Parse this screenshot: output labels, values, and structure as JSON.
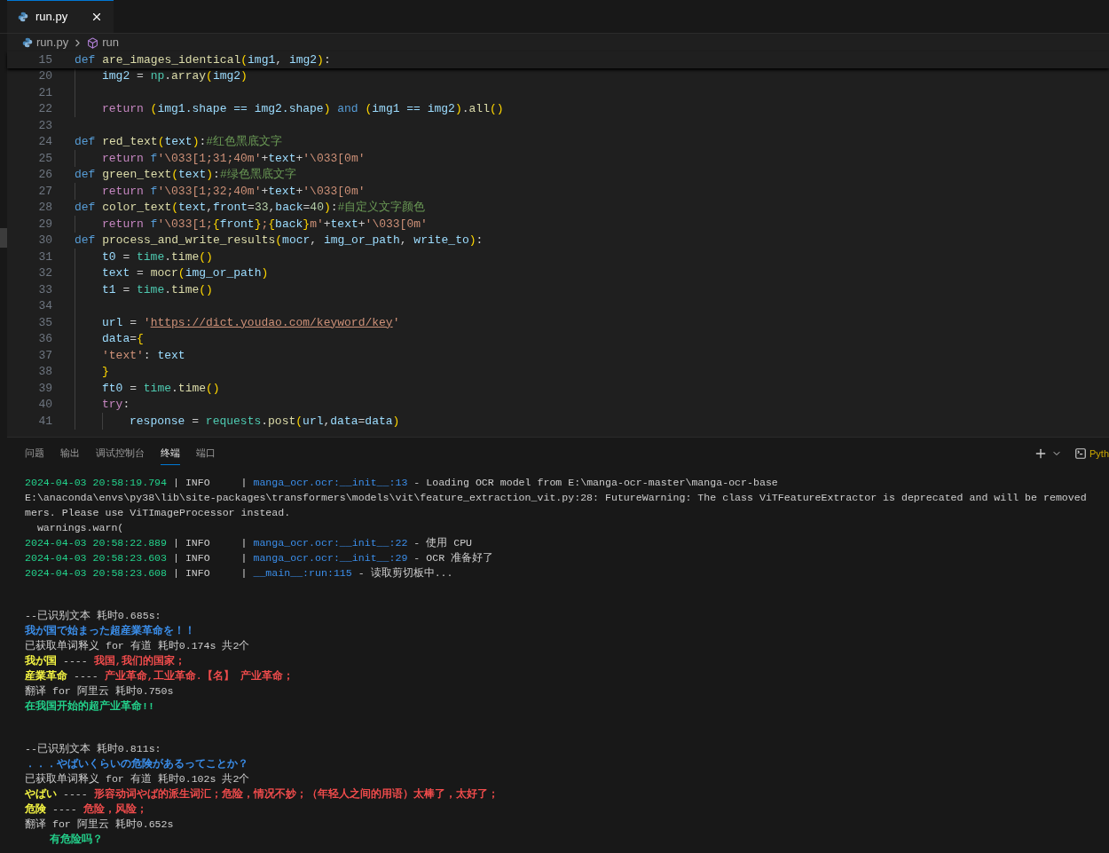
{
  "tabs": [
    {
      "label": "run.py",
      "selected": true
    }
  ],
  "breadcrumb": [
    "run.py",
    "run"
  ],
  "code": [
    {
      "number": "15",
      "tokens": [
        {
          "kind": "kw",
          "text": "def "
        },
        {
          "kind": "fn",
          "text": "are_images_identical"
        },
        {
          "kind": "paren",
          "text": "("
        },
        {
          "kind": "param",
          "text": "img1"
        },
        {
          "kind": "plain",
          "text": ", "
        },
        {
          "kind": "param",
          "text": "img2"
        },
        {
          "kind": "paren",
          "text": ")"
        },
        {
          "kind": "plain",
          "text": ":"
        }
      ],
      "children": [
        {
          "number": "20",
          "tokens": [
            {
              "kind": "param",
              "text": "img2"
            },
            {
              "kind": "plain",
              "text": " = "
            },
            {
              "kind": "builtin",
              "text": "np"
            },
            {
              "kind": "plain",
              "text": "."
            },
            {
              "kind": "fn",
              "text": "array"
            },
            {
              "kind": "paren",
              "text": "("
            },
            {
              "kind": "param",
              "text": "img2"
            },
            {
              "kind": "paren",
              "text": ")"
            }
          ]
        },
        {
          "number": "21"
        },
        {
          "number": "22",
          "tokens": [
            {
              "kind": "ctrl",
              "text": "return "
            },
            {
              "kind": "paren",
              "text": "("
            },
            {
              "kind": "param",
              "text": "img1.shape == img2.shape"
            },
            {
              "kind": "paren",
              "text": ")"
            },
            {
              "kind": "kw",
              "text": " and "
            },
            {
              "kind": "paren",
              "text": "("
            },
            {
              "kind": "param",
              "text": "img1 == img2"
            },
            {
              "kind": "paren",
              "text": ")"
            },
            {
              "kind": "plain",
              "text": "."
            },
            {
              "kind": "fn",
              "text": "all"
            },
            {
              "kind": "paren",
              "text": "()"
            }
          ]
        }
      ]
    },
    {
      "number": "23"
    },
    {
      "number": "24",
      "tokens": [
        {
          "kind": "kw",
          "text": "def "
        },
        {
          "kind": "fn",
          "text": "red_text"
        },
        {
          "kind": "paren",
          "text": "("
        },
        {
          "kind": "param",
          "text": "text"
        },
        {
          "kind": "paren",
          "text": ")"
        },
        {
          "kind": "plain",
          "text": ":"
        },
        {
          "kind": "comment",
          "text": "#红色黑底文字"
        }
      ],
      "children": [
        {
          "number": "25",
          "tokens": [
            {
              "kind": "ctrl",
              "text": "return "
            },
            {
              "kind": "kw",
              "text": "f"
            },
            {
              "kind": "string",
              "text": "'\\033[1;31;40m'"
            },
            {
              "kind": "plain",
              "text": "+"
            },
            {
              "kind": "param",
              "text": "text"
            },
            {
              "kind": "plain",
              "text": "+"
            },
            {
              "kind": "string",
              "text": "'\\033[0m'"
            }
          ]
        }
      ]
    },
    {
      "number": "26",
      "tokens": [
        {
          "kind": "kw",
          "text": "def "
        },
        {
          "kind": "fn",
          "text": "green_text"
        },
        {
          "kind": "paren",
          "text": "("
        },
        {
          "kind": "param",
          "text": "text"
        },
        {
          "kind": "paren",
          "text": ")"
        },
        {
          "kind": "plain",
          "text": ":"
        },
        {
          "kind": "comment",
          "text": "#绿色黑底文字"
        }
      ],
      "children": [
        {
          "number": "27",
          "tokens": [
            {
              "kind": "ctrl",
              "text": "return "
            },
            {
              "kind": "kw",
              "text": "f"
            },
            {
              "kind": "string",
              "text": "'\\033[1;32;40m'"
            },
            {
              "kind": "plain",
              "text": "+"
            },
            {
              "kind": "param",
              "text": "text"
            },
            {
              "kind": "plain",
              "text": "+"
            },
            {
              "kind": "string",
              "text": "'\\033[0m'"
            }
          ]
        }
      ]
    },
    {
      "number": "28",
      "tokens": [
        {
          "kind": "kw",
          "text": "def "
        },
        {
          "kind": "fn",
          "text": "color_text"
        },
        {
          "kind": "paren",
          "text": "("
        },
        {
          "kind": "param",
          "text": "text"
        },
        {
          "kind": "plain",
          "text": ","
        },
        {
          "kind": "param",
          "text": "front"
        },
        {
          "kind": "plain",
          "text": "="
        },
        {
          "kind": "number",
          "text": "33"
        },
        {
          "kind": "plain",
          "text": ","
        },
        {
          "kind": "param",
          "text": "back"
        },
        {
          "kind": "plain",
          "text": "="
        },
        {
          "kind": "number",
          "text": "40"
        },
        {
          "kind": "paren",
          "text": ")"
        },
        {
          "kind": "plain",
          "text": ":"
        },
        {
          "kind": "comment",
          "text": "#自定义文字颜色"
        }
      ],
      "children": [
        {
          "number": "29",
          "tokens": [
            {
              "kind": "ctrl",
              "text": "return "
            },
            {
              "kind": "kw",
              "text": "f"
            },
            {
              "kind": "string",
              "text": "'\\033[1;"
            },
            {
              "kind": "paren",
              "text": "{"
            },
            {
              "kind": "param",
              "text": "front"
            },
            {
              "kind": "paren",
              "text": "}"
            },
            {
              "kind": "string",
              "text": ";"
            },
            {
              "kind": "paren",
              "text": "{"
            },
            {
              "kind": "param",
              "text": "back"
            },
            {
              "kind": "paren",
              "text": "}"
            },
            {
              "kind": "string",
              "text": "m'"
            },
            {
              "kind": "plain",
              "text": "+"
            },
            {
              "kind": "param",
              "text": "text"
            },
            {
              "kind": "plain",
              "text": "+"
            },
            {
              "kind": "string",
              "text": "'\\033[0m'"
            }
          ]
        }
      ]
    },
    {
      "number": "30",
      "tokens": [
        {
          "kind": "kw",
          "text": "def "
        },
        {
          "kind": "fn",
          "text": "process_and_write_results"
        },
        {
          "kind": "paren",
          "text": "("
        },
        {
          "kind": "param",
          "text": "mocr"
        },
        {
          "kind": "plain",
          "text": ", "
        },
        {
          "kind": "param",
          "text": "img_or_path"
        },
        {
          "kind": "plain",
          "text": ", "
        },
        {
          "kind": "param",
          "text": "write_to"
        },
        {
          "kind": "paren",
          "text": ")"
        },
        {
          "kind": "plain",
          "text": ":"
        }
      ],
      "children": [
        {
          "number": "31",
          "tokens": [
            {
              "kind": "param",
              "text": "t0"
            },
            {
              "kind": "plain",
              "text": " = "
            },
            {
              "kind": "builtin",
              "text": "time"
            },
            {
              "kind": "plain",
              "text": "."
            },
            {
              "kind": "fn",
              "text": "time"
            },
            {
              "kind": "paren",
              "text": "()"
            }
          ]
        },
        {
          "number": "32",
          "tokens": [
            {
              "kind": "param",
              "text": "text"
            },
            {
              "kind": "plain",
              "text": " = "
            },
            {
              "kind": "fn",
              "text": "mocr"
            },
            {
              "kind": "paren",
              "text": "("
            },
            {
              "kind": "param",
              "text": "img_or_path"
            },
            {
              "kind": "paren",
              "text": ")"
            }
          ]
        },
        {
          "number": "33",
          "tokens": [
            {
              "kind": "param",
              "text": "t1"
            },
            {
              "kind": "plain",
              "text": " = "
            },
            {
              "kind": "builtin",
              "text": "time"
            },
            {
              "kind": "plain",
              "text": "."
            },
            {
              "kind": "fn",
              "text": "time"
            },
            {
              "kind": "paren",
              "text": "()"
            }
          ]
        },
        {
          "number": "34"
        },
        {
          "number": "35",
          "tokens": [
            {
              "kind": "param",
              "text": "url"
            },
            {
              "kind": "plain",
              "text": " = "
            },
            {
              "kind": "string",
              "text": "'"
            },
            {
              "kind": "link",
              "text": "https://dict.youdao.com/keyword/key"
            },
            {
              "kind": "string",
              "text": "'"
            }
          ]
        },
        {
          "number": "36",
          "tokens": [
            {
              "kind": "param",
              "text": "data"
            },
            {
              "kind": "plain",
              "text": "="
            },
            {
              "kind": "paren",
              "text": "{"
            }
          ]
        },
        {
          "number": "37",
          "tokens": [
            {
              "kind": "string",
              "text": "'text'"
            },
            {
              "kind": "plain",
              "text": ": "
            },
            {
              "kind": "param",
              "text": "text"
            }
          ]
        },
        {
          "number": "38",
          "tokens": [
            {
              "kind": "paren",
              "text": "}"
            }
          ]
        },
        {
          "number": "39",
          "tokens": [
            {
              "kind": "param",
              "text": "ft0"
            },
            {
              "kind": "plain",
              "text": " = "
            },
            {
              "kind": "builtin",
              "text": "time"
            },
            {
              "kind": "plain",
              "text": "."
            },
            {
              "kind": "fn",
              "text": "time"
            },
            {
              "kind": "paren",
              "text": "()"
            }
          ]
        },
        {
          "number": "40",
          "tokens": [
            {
              "kind": "ctrl",
              "text": "try"
            },
            {
              "kind": "plain",
              "text": ":"
            }
          ],
          "children": [
            {
              "number": "41",
              "tokens": [
                {
                  "kind": "param",
                  "text": "response"
                },
                {
                  "kind": "plain",
                  "text": " = "
                },
                {
                  "kind": "builtin",
                  "text": "requests"
                },
                {
                  "kind": "plain",
                  "text": "."
                },
                {
                  "kind": "fn",
                  "text": "post"
                },
                {
                  "kind": "paren",
                  "text": "("
                },
                {
                  "kind": "param",
                  "text": "url"
                },
                {
                  "kind": "plain",
                  "text": ","
                },
                {
                  "kind": "param",
                  "text": "data"
                },
                {
                  "kind": "plain",
                  "text": "="
                },
                {
                  "kind": "param",
                  "text": "data"
                },
                {
                  "kind": "paren",
                  "text": ")"
                }
              ]
            }
          ]
        }
      ]
    }
  ],
  "panel_tabs": [
    {
      "label": "问题",
      "selected": false
    },
    {
      "label": "输出",
      "selected": false
    },
    {
      "label": "调试控制台",
      "selected": false
    },
    {
      "label": "终端",
      "selected": true
    },
    {
      "label": "端口",
      "selected": false
    }
  ],
  "terminal_profile": "Pyth",
  "terminal_blocks": [
    {
      "lines": [
        [
          {
            "kind": "ts",
            "text": "2024-04-03 20:58:19.794"
          },
          {
            "kind": "plain",
            "text": " | INFO     | "
          },
          {
            "kind": "mod",
            "text": "manga_ocr.ocr:__init__:13"
          },
          {
            "kind": "plain",
            "text": " - Loading OCR model from E:\\manga-ocr-master\\manga-ocr-base"
          }
        ],
        [
          {
            "kind": "plain",
            "text": "E:\\anaconda\\envs\\py38\\lib\\site-packages\\transformers\\models\\vit\\feature_extraction_vit.py:28: FutureWarning: The class ViTFeatureExtractor is deprecated and will be removed"
          }
        ],
        [
          {
            "kind": "plain",
            "text": "mers. Please use ViTImageProcessor instead."
          }
        ],
        [
          {
            "kind": "plain",
            "text": "  warnings.warn("
          }
        ],
        [
          {
            "kind": "ts",
            "text": "2024-04-03 20:58:22.889"
          },
          {
            "kind": "plain",
            "text": " | INFO     | "
          },
          {
            "kind": "mod",
            "text": "manga_ocr.ocr:__init__:22"
          },
          {
            "kind": "plain",
            "text": " - 使用 CPU"
          }
        ],
        [
          {
            "kind": "ts",
            "text": "2024-04-03 20:58:23.603"
          },
          {
            "kind": "plain",
            "text": " | INFO     | "
          },
          {
            "kind": "mod",
            "text": "manga_ocr.ocr:__init__:29"
          },
          {
            "kind": "plain",
            "text": " - OCR 准备好了"
          }
        ],
        [
          {
            "kind": "ts",
            "text": "2024-04-03 20:58:23.608"
          },
          {
            "kind": "plain",
            "text": " | INFO     | "
          },
          {
            "kind": "mod",
            "text": "__main__:run:115"
          },
          {
            "kind": "plain",
            "text": " - 读取剪切板中..."
          }
        ]
      ]
    },
    {
      "lines": [
        [
          {
            "kind": "plain",
            "text": "--已识别文本 耗时0.685s:"
          }
        ],
        [
          {
            "kind": "blue",
            "text": "我が国で始まった超産業革命を！！"
          }
        ],
        [
          {
            "kind": "plain",
            "text": "已获取单词释义 for 有道 耗时0.174s 共2个"
          }
        ],
        [
          {
            "kind": "yellow",
            "text": "我が国"
          },
          {
            "kind": "plain",
            "text": " ---- "
          },
          {
            "kind": "red",
            "text": "我国,我们的国家；"
          }
        ],
        [
          {
            "kind": "yellow",
            "text": "産業革命"
          },
          {
            "kind": "plain",
            "text": " ---- "
          },
          {
            "kind": "red",
            "text": "产业革命,工业革命.【名】 产业革命；"
          }
        ],
        [
          {
            "kind": "plain",
            "text": "翻译 for 阿里云 耗时0.750s"
          }
        ],
        [
          {
            "kind": "green",
            "text": "在我国开始的超产业革命!!"
          }
        ]
      ]
    },
    {
      "lines": [
        [
          {
            "kind": "plain",
            "text": "--已识别文本 耗时0.811s:"
          }
        ],
        [
          {
            "kind": "blue",
            "text": "．．．やばいくらいの危険があるってことか？"
          }
        ],
        [
          {
            "kind": "plain",
            "text": "已获取单词释义 for 有道 耗时0.102s 共2个"
          }
        ],
        [
          {
            "kind": "yellow",
            "text": "やばい"
          },
          {
            "kind": "plain",
            "text": " ---- "
          },
          {
            "kind": "red",
            "text": "形容动词やば的派生词汇；危险，情况不妙；（年轻人之间的用语）太棒了，太好了；"
          }
        ],
        [
          {
            "kind": "yellow",
            "text": "危険"
          },
          {
            "kind": "plain",
            "text": " ---- "
          },
          {
            "kind": "red",
            "text": "危险，风险；"
          }
        ],
        [
          {
            "kind": "plain",
            "text": "翻译 for 阿里云 耗时0.652s"
          }
        ],
        [
          {
            "kind": "indented-green",
            "text": "有危险吗？"
          }
        ]
      ]
    }
  ]
}
